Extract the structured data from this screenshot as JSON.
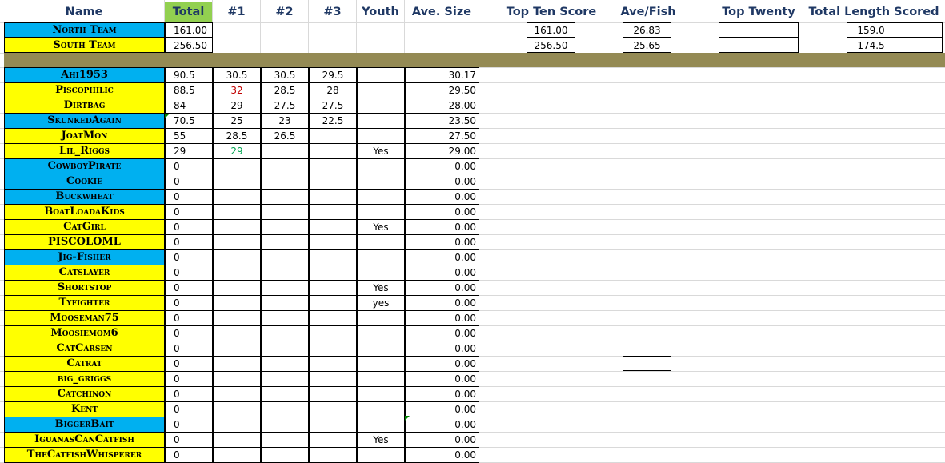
{
  "headers": {
    "name": "Name",
    "total": "Total",
    "n1": "#1",
    "n2": "#2",
    "n3": "#3",
    "youth": "Youth",
    "ave_size": "Ave. Size",
    "top_ten": "Top Ten Score",
    "ave_fish": "Ave/Fish",
    "top_twenty": "Top Twenty",
    "total_length": "Total Length Scored"
  },
  "colors": {
    "header_text": "#1f3864",
    "total_header_bg": "#92d050",
    "blue": "#00b0f0",
    "yellow": "#ffff00",
    "divider": "#948a54"
  },
  "teams": [
    {
      "name": "North Team",
      "total": "161.00",
      "top_ten": "161.00",
      "ave_fish": "26.83",
      "total_length": "159.0"
    },
    {
      "name": "South Team",
      "total": "256.50",
      "top_ten": "256.50",
      "ave_fish": "25.65",
      "total_length": "174.5"
    }
  ],
  "players": [
    {
      "name": "Ahi1953",
      "color": "blue",
      "total": "90.5",
      "n1": "30.5",
      "n2": "30.5",
      "n3": "29.5",
      "youth": "",
      "ave": "30.17"
    },
    {
      "name": "Piscophilic",
      "color": "yellow",
      "total": "88.5",
      "n1": "32",
      "n1_color": "red",
      "n2": "28.5",
      "n3": "28",
      "youth": "",
      "ave": "29.50"
    },
    {
      "name": "Dirtbag",
      "color": "yellow",
      "total": "84",
      "n1": "29",
      "n2": "27.5",
      "n3": "27.5",
      "youth": "",
      "ave": "28.00"
    },
    {
      "name": "SkunkedAgain",
      "color": "blue",
      "total": "70.5",
      "n1": "25",
      "n2": "23",
      "n3": "22.5",
      "youth": "",
      "ave": "23.50"
    },
    {
      "name": "JoatMon",
      "color": "yellow",
      "total": "55",
      "n1": "28.5",
      "n2": "26.5",
      "n3": "",
      "youth": "",
      "ave": "27.50"
    },
    {
      "name": "Lil_Riggs",
      "color": "yellow",
      "total": "29",
      "n1": "29",
      "n1_color": "green",
      "n2": "",
      "n3": "",
      "youth": "Yes",
      "ave": "29.00"
    },
    {
      "name": "CowboyPirate",
      "color": "blue",
      "total": "0",
      "n1": "",
      "n2": "",
      "n3": "",
      "youth": "",
      "ave": "0.00"
    },
    {
      "name": "Cookie",
      "color": "blue",
      "total": "0",
      "n1": "",
      "n2": "",
      "n3": "",
      "youth": "",
      "ave": "0.00"
    },
    {
      "name": "Buckwheat",
      "color": "blue",
      "total": "0",
      "n1": "",
      "n2": "",
      "n3": "",
      "youth": "",
      "ave": "0.00"
    },
    {
      "name": "BoatLoadaKids",
      "color": "yellow",
      "total": "0",
      "n1": "",
      "n2": "",
      "n3": "",
      "youth": "",
      "ave": "0.00"
    },
    {
      "name": "CatGirl",
      "color": "yellow",
      "total": "0",
      "n1": "",
      "n2": "",
      "n3": "",
      "youth": "Yes",
      "ave": "0.00"
    },
    {
      "name": "PISCOLOML",
      "color": "yellow",
      "total": "0",
      "n1": "",
      "n2": "",
      "n3": "",
      "youth": "",
      "ave": "0.00"
    },
    {
      "name": "Jig-Fisher",
      "color": "blue",
      "total": "0",
      "n1": "",
      "n2": "",
      "n3": "",
      "youth": "",
      "ave": "0.00"
    },
    {
      "name": "Catslayer",
      "color": "yellow",
      "total": "0",
      "n1": "",
      "n2": "",
      "n3": "",
      "youth": "",
      "ave": "0.00"
    },
    {
      "name": "Shortstop",
      "color": "yellow",
      "total": "0",
      "n1": "",
      "n2": "",
      "n3": "",
      "youth": "Yes",
      "ave": "0.00"
    },
    {
      "name": "Tyfighter",
      "color": "yellow",
      "total": "0",
      "n1": "",
      "n2": "",
      "n3": "",
      "youth": "yes",
      "ave": "0.00"
    },
    {
      "name": "Mooseman75",
      "color": "yellow",
      "total": "0",
      "n1": "",
      "n2": "",
      "n3": "",
      "youth": "",
      "ave": "0.00"
    },
    {
      "name": "Moosiemom6",
      "color": "yellow",
      "total": "0",
      "n1": "",
      "n2": "",
      "n3": "",
      "youth": "",
      "ave": "0.00"
    },
    {
      "name": "CatCarsen",
      "color": "yellow",
      "total": "0",
      "n1": "",
      "n2": "",
      "n3": "",
      "youth": "",
      "ave": "0.00"
    },
    {
      "name": "Catrat",
      "color": "yellow",
      "total": "0",
      "n1": "",
      "n2": "",
      "n3": "",
      "youth": "",
      "ave": "0.00"
    },
    {
      "name": "big_griggs",
      "color": "yellow",
      "total": "0",
      "n1": "",
      "n2": "",
      "n3": "",
      "youth": "",
      "ave": "0.00"
    },
    {
      "name": "Catchinon",
      "color": "yellow",
      "total": "0",
      "n1": "",
      "n2": "",
      "n3": "",
      "youth": "",
      "ave": "0.00"
    },
    {
      "name": "Kent",
      "color": "yellow",
      "total": "0",
      "n1": "",
      "n2": "",
      "n3": "",
      "youth": "",
      "ave": "0.00"
    },
    {
      "name": "BiggerBait",
      "color": "blue",
      "total": "0",
      "n1": "",
      "n2": "",
      "n3": "",
      "youth": "",
      "ave": "0.00"
    },
    {
      "name": "IguanasCanCatfish",
      "color": "yellow",
      "total": "0",
      "n1": "",
      "n2": "",
      "n3": "",
      "youth": "Yes",
      "ave": "0.00"
    },
    {
      "name": "TheCatfishWhisperer",
      "color": "yellow",
      "total": "0",
      "n1": "",
      "n2": "",
      "n3": "",
      "youth": "",
      "ave": "0.00"
    }
  ]
}
